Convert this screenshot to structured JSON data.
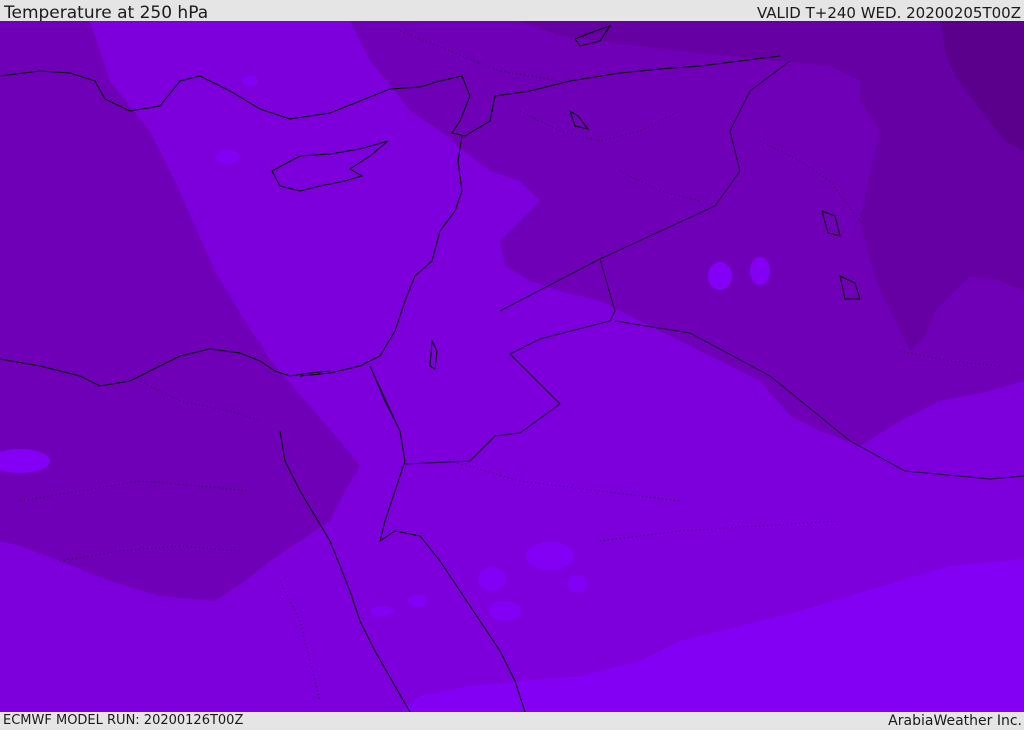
{
  "header": {
    "title": "Temperature at 250 hPa",
    "valid": "VALID T+240 WED. 20200205T00Z"
  },
  "footer": {
    "model_run": "ECMWF MODEL RUN: 20200126T00Z",
    "brand": "ArabiaWeather Inc."
  },
  "colors": {
    "band_darkest": "#5e0090",
    "band_dark": "#6c00a8",
    "band_mid": "#7600c0",
    "band_main": "#7d00dc",
    "band_light": "#8400f4",
    "band_lightest": "#8a2bff",
    "coastline": "#000000",
    "bar_background": "#e5e5e5"
  }
}
